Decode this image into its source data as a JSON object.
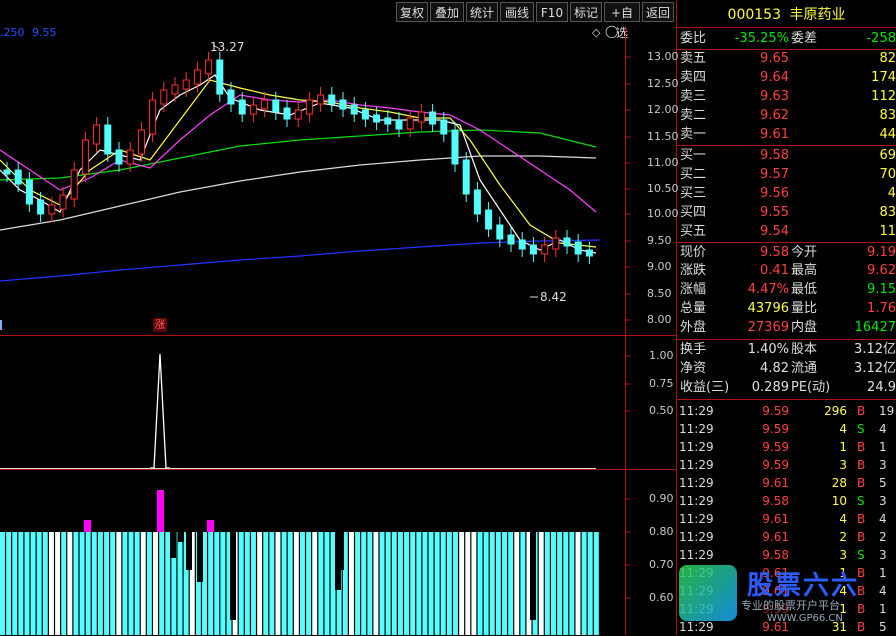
{
  "toolbar": {
    "buttons": [
      "复权",
      "叠加",
      "统计",
      "画线",
      "F10",
      "标记",
      "+自选",
      "返回"
    ]
  },
  "chart_header": {
    "ma_label": ".250",
    "ma_value": "9.55"
  },
  "stock": {
    "code": "000153",
    "name": "丰原药业"
  },
  "order_book": {
    "weibi_label": "委比",
    "weibi_value": "-35.25%",
    "weicha_label": "委差",
    "weicha_value": "-258",
    "asks": [
      {
        "label": "卖五",
        "price": "9.65",
        "vol": "82"
      },
      {
        "label": "卖四",
        "price": "9.64",
        "vol": "174"
      },
      {
        "label": "卖三",
        "price": "9.63",
        "vol": "112"
      },
      {
        "label": "卖二",
        "price": "9.62",
        "vol": "83"
      },
      {
        "label": "卖一",
        "price": "9.61",
        "vol": "44"
      }
    ],
    "bids": [
      {
        "label": "买一",
        "price": "9.58",
        "vol": "69"
      },
      {
        "label": "买二",
        "price": "9.57",
        "vol": "70"
      },
      {
        "label": "买三",
        "price": "9.56",
        "vol": "4"
      },
      {
        "label": "买四",
        "price": "9.55",
        "vol": "83"
      },
      {
        "label": "买五",
        "price": "9.54",
        "vol": "11"
      }
    ]
  },
  "quote": {
    "xianjia_label": "现价",
    "xianjia": "9.58",
    "jinkai_label": "今开",
    "jinkai": "9.19",
    "zhangdie_label": "涨跌",
    "zhangdie": "0.41",
    "zuigao_label": "最高",
    "zuigao": "9.62",
    "zhangfu_label": "涨幅",
    "zhangfu": "4.47%",
    "zuidi_label": "最低",
    "zuidi": "9.15",
    "zongliang_label": "总量",
    "zongliang": "43796",
    "liangbi_label": "量比",
    "liangbi": "1.76",
    "waipan_label": "外盘",
    "waipan": "27369",
    "neipan_label": "内盘",
    "neipan": "16427"
  },
  "fundamentals": {
    "huanshou_label": "换手",
    "huanshou": "1.40%",
    "guben_label": "股本",
    "guben": "3.12亿",
    "jingzi_label": "净资",
    "jingzi": "4.82",
    "liutong_label": "流通",
    "liutong": "3.12亿",
    "shouyi_label": "收益(三)",
    "shouyi": "0.289",
    "pe_label": "PE(动)",
    "pe": "24.9"
  },
  "ticks": [
    {
      "time": "11:29",
      "price": "9.59",
      "vol": "296",
      "side": "B",
      "extra": "19"
    },
    {
      "time": "11:29",
      "price": "9.59",
      "vol": "4",
      "side": "S",
      "extra": "4"
    },
    {
      "time": "11:29",
      "price": "9.59",
      "vol": "1",
      "side": "B",
      "extra": "1"
    },
    {
      "time": "11:29",
      "price": "9.59",
      "vol": "3",
      "side": "B",
      "extra": "3"
    },
    {
      "time": "11:29",
      "price": "9.61",
      "vol": "28",
      "side": "B",
      "extra": "5"
    },
    {
      "time": "11:29",
      "price": "9.58",
      "vol": "10",
      "side": "S",
      "extra": "3"
    },
    {
      "time": "11:29",
      "price": "9.61",
      "vol": "4",
      "side": "B",
      "extra": "4"
    },
    {
      "time": "11:29",
      "price": "9.61",
      "vol": "2",
      "side": "B",
      "extra": "2"
    },
    {
      "time": "11:29",
      "price": "9.58",
      "vol": "3",
      "side": "S",
      "extra": "3"
    },
    {
      "time": "11:29",
      "price": "9.61",
      "vol": "1",
      "side": "B",
      "extra": "1"
    },
    {
      "time": "11:29",
      "price": "9.61",
      "vol": "4",
      "side": "B",
      "extra": "4"
    },
    {
      "time": "11:29",
      "price": "9.59",
      "vol": "1",
      "side": "B",
      "extra": "1"
    },
    {
      "time": "11:29",
      "price": "9.61",
      "vol": "31",
      "side": "B",
      "extra": "5"
    }
  ],
  "price_axis": [
    "13.00",
    "12.50",
    "12.00",
    "11.50",
    "11.00",
    "10.50",
    "10.00",
    "9.50",
    "9.00",
    "8.50",
    "8.00"
  ],
  "ind1_axis": [
    "1.00",
    "0.75",
    "0.50"
  ],
  "ind2_axis": [
    "0.90",
    "0.80",
    "0.70",
    "0.60"
  ],
  "annotations": {
    "high": "13.27",
    "low": "8.42",
    "signal": "涨"
  },
  "watermark": {
    "title": "股票六六",
    "line1": "专业的股票开户平台",
    "url": "WWW.GP66.CN"
  },
  "colors": {
    "up": "#ff3030",
    "down": "#54ffff",
    "ma5": "#ffffff",
    "ma10": "#ffff40",
    "ma20": "#ff40ff",
    "ma60": "#00ff00",
    "ma120": "#e0e0e0",
    "ma250": "#2020ff"
  }
}
